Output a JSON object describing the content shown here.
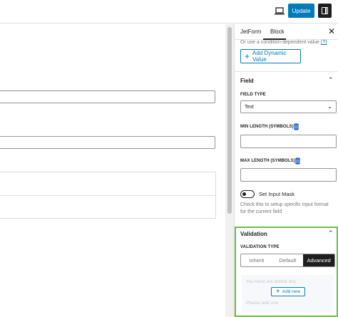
{
  "toolbar": {
    "update_label": "Update",
    "preview_icon": "laptop-icon",
    "settings_icon": "sidebar-toggle-icon"
  },
  "sidebar": {
    "tabs": [
      {
        "label": "JetForm"
      },
      {
        "label": "Block",
        "active": true
      }
    ],
    "close_icon": "close-icon",
    "dynamic_value": {
      "helper_text": "Or use a condition-dependent value",
      "help_link": "(?)",
      "button_label": "Add Dynamic Value"
    },
    "field_section": {
      "title": "Field",
      "field_type_label": "FIELD TYPE",
      "field_type_value": "Text",
      "min_length_label": "MIN LENGTH (SYMBOLS)",
      "max_length_label": "MAX LENGTH (SYMBOLS)",
      "input_mask_label": "Set Input Mask",
      "input_mask_help": "Check this to setup specific input format for the current field"
    },
    "validation_section": {
      "title": "Validation",
      "type_label": "VALIDATION TYPE",
      "options": [
        "Inherit",
        "Default",
        "Advanced"
      ],
      "selected": "Advanced",
      "add_new_label": "Add new",
      "faded_line_1": "You have not added any",
      "faded_line_2": "Please add one"
    }
  },
  "colors": {
    "accent": "#007cba",
    "highlight": "#6cc04a",
    "dark": "#1e1e1e"
  }
}
